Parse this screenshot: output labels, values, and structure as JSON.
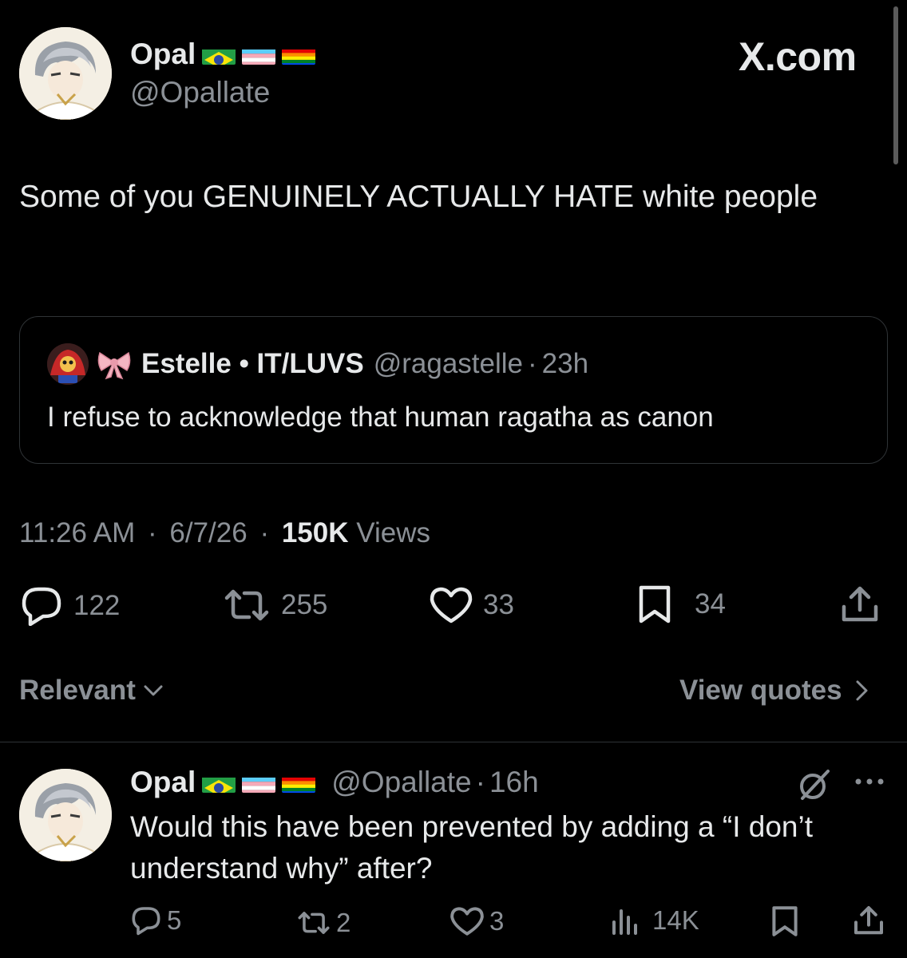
{
  "brand": "X.com",
  "tweet": {
    "author": {
      "name": "Opal",
      "handle": "@Opallate",
      "flags": [
        "brazil-flag",
        "transgender-flag",
        "rainbow-flag"
      ]
    },
    "text": "Some of you GENUINELY ACTUALLY HATE white people",
    "quoted": {
      "name": "Estelle • IT/LUVS",
      "handle": "@ragastelle",
      "separator": "·",
      "time": "23h",
      "text": "I refuse to acknowledge that human ragatha as canon"
    },
    "meta": {
      "time": "11:26 AM",
      "date": "6/7/26",
      "separator": "·",
      "views_count": "150K",
      "views_label": "Views"
    },
    "actions": {
      "replies": "122",
      "reposts": "255",
      "likes": "33",
      "bookmarks": "34"
    }
  },
  "filters": {
    "sort_label": "Relevant",
    "view_quotes_label": "View quotes"
  },
  "reply": {
    "author": {
      "name": "Opal",
      "handle": "@Opallate",
      "flags": [
        "brazil-flag",
        "transgender-flag",
        "rainbow-flag"
      ]
    },
    "separator": "·",
    "time": "16h",
    "text": "Would this have been prevented by adding a “I don’t understand why” after?",
    "actions": {
      "replies": "5",
      "reposts": "2",
      "likes": "3",
      "views": "14K"
    }
  },
  "colors": {
    "background": "#000000",
    "text_primary": "#e7e9ea",
    "text_secondary": "#8b9096",
    "border": "#2f3336"
  }
}
